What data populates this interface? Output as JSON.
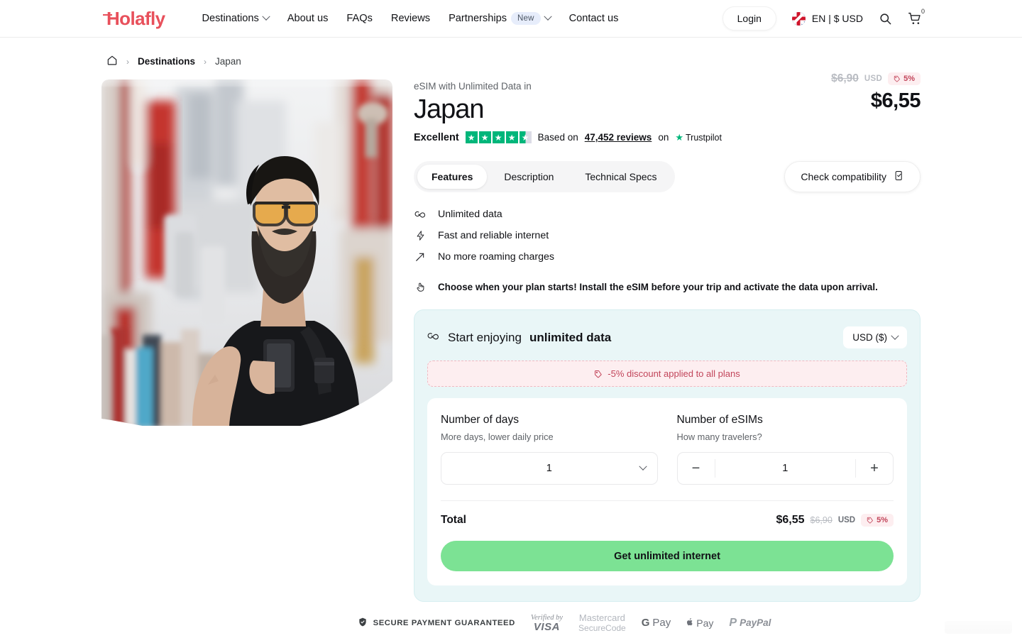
{
  "header": {
    "logo": "Holafly",
    "nav": [
      {
        "label": "Destinations",
        "has_chevron": true,
        "badge": null
      },
      {
        "label": "About us",
        "has_chevron": false,
        "badge": null
      },
      {
        "label": "FAQs",
        "has_chevron": false,
        "badge": null
      },
      {
        "label": "Reviews",
        "has_chevron": false,
        "badge": null
      },
      {
        "label": "Partnerships",
        "has_chevron": true,
        "badge": "New"
      },
      {
        "label": "Contact us",
        "has_chevron": false,
        "badge": null
      }
    ],
    "login_label": "Login",
    "locale": "EN | $ USD",
    "flag_icon": "uk-flag-icon",
    "search_icon": "search-icon",
    "cart_icon": "cart-icon",
    "cart_count": "0"
  },
  "breadcrumb": {
    "home_icon": "home-icon",
    "separator": "›",
    "items": [
      {
        "label": "Destinations"
      },
      {
        "label": "Japan"
      }
    ]
  },
  "product": {
    "eyebrow": "eSIM with Unlimited Data in",
    "title": "Japan",
    "rating": {
      "word": "Excellent",
      "stars": 4.5,
      "based_on_prefix": "Based on",
      "reviews_link": "47,452 reviews",
      "on_text": "on",
      "platform": "Trustpilot",
      "star_color": "#00b67a"
    },
    "price": {
      "old": "$6,90",
      "currency": "USD",
      "discount_badge": "5%",
      "current": "$6,55"
    }
  },
  "tabs": {
    "items": [
      {
        "label": "Features",
        "active": true
      },
      {
        "label": "Description",
        "active": false
      },
      {
        "label": "Technical Specs",
        "active": false
      }
    ],
    "compat_label": "Check compatibility",
    "compat_icon": "phone-check-icon"
  },
  "features": {
    "items": [
      {
        "icon": "infinity-icon",
        "glyph": "∞",
        "label": "Unlimited data"
      },
      {
        "icon": "lightning-bolt-icon",
        "glyph": "⚡",
        "label": "Fast and reliable internet"
      },
      {
        "icon": "no-roaming-icon",
        "glyph": "↗",
        "label": "No more roaming charges"
      }
    ],
    "notice_icon": "hand-tap-icon",
    "notice": "Choose when your plan starts! Install the eSIM before your trip and activate the data upon arrival."
  },
  "purchase": {
    "infinity_icon": "infinity-icon",
    "title_plain": "Start enjoying",
    "title_bold": "unlimited data",
    "currency_selector": "USD ($)",
    "promo_icon": "tag-icon",
    "promo": "-5% discount applied to all plans",
    "days": {
      "title": "Number of days",
      "subtitle": "More days, lower daily price",
      "value": "1"
    },
    "esims": {
      "title": "Number of eSIMs",
      "subtitle": "How many travelers?",
      "value": "1",
      "minus": "−",
      "plus": "+"
    },
    "total": {
      "label": "Total",
      "current": "$6,55",
      "old": "$6,90",
      "currency": "USD",
      "discount_badge": "5%"
    },
    "cta_label": "Get unlimited internet"
  },
  "payments": {
    "shield_icon": "shield-check-icon",
    "secure_text": "SECURE PAYMENT GUARANTEED",
    "visa_line1": "Verified by",
    "visa_line2": "VISA",
    "mc_line1": "Mastercard",
    "mc_line2": "SecureCode",
    "gpay_mark": "G",
    "gpay_label": "Pay",
    "apay_mark": "",
    "apay_label": "Pay",
    "paypal_mark": "P",
    "paypal_label": "PayPal"
  },
  "colors": {
    "brand": "#e8505b",
    "cta": "#7ce294",
    "card_bg": "#e9f6f7",
    "promo_bg": "#fdeef0",
    "promo_text": "#c2455a",
    "trustpilot_green": "#00b67a"
  }
}
